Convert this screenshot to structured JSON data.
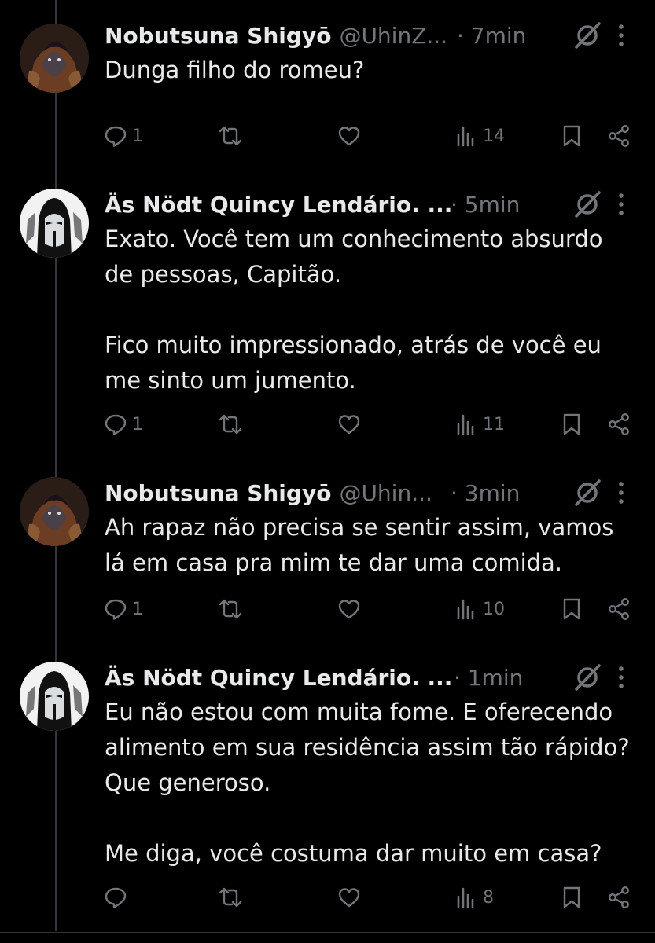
{
  "colors": {
    "background": "#000000",
    "text": "#e7e9ea",
    "muted": "#71767b",
    "thread_line": "#333639"
  },
  "tweets": [
    {
      "name": "Nobutsuna Shigyō",
      "handle": "@UhinZ...",
      "time": "· 7min",
      "lines": [
        "Dunga filho do romeu?"
      ],
      "avatar": "avatar-nobutsuna",
      "stats": {
        "replies": "1",
        "retweets": "",
        "likes": "",
        "views": "14"
      }
    },
    {
      "name": "Äs Nödt Quincy Lendário. ...",
      "handle": "",
      "time": "· 5min",
      "lines": [
        "Exato. Você tem um conhecimento absurdo",
        "de pessoas, Capitão.",
        "Fico muito impressionado, atrás de você eu",
        "me sinto um jumento."
      ],
      "avatar": "avatar-as-nodt",
      "stats": {
        "replies": "1",
        "retweets": "",
        "likes": "",
        "views": "11"
      }
    },
    {
      "name": "Nobutsuna Shigyō",
      "handle": "@Uhin...",
      "time": "· 3min",
      "lines": [
        "Ah rapaz não precisa se sentir assim, vamos",
        "lá em casa pra mim te dar uma comida."
      ],
      "avatar": "avatar-nobutsuna",
      "stats": {
        "replies": "1",
        "retweets": "",
        "likes": "",
        "views": "10"
      }
    },
    {
      "name": "Äs Nödt Quincy Lendário. ...",
      "handle": "",
      "time": "· 1min",
      "lines": [
        "Eu não estou com muita fome. E oferecendo",
        "alimento em sua residência assim tão rápido?",
        "Que generoso.",
        "Me diga, você costuma dar muito em casa?"
      ],
      "avatar": "avatar-as-nodt",
      "stats": {
        "replies": "",
        "retweets": "",
        "likes": "",
        "views": "8"
      }
    }
  ],
  "icons": {
    "reply": "reply-icon",
    "retweet": "retweet-icon",
    "like": "like-icon",
    "views": "views-icon",
    "bookmark": "bookmark-icon",
    "share": "share-icon",
    "grok": "grok-icon",
    "more": "more-icon"
  }
}
